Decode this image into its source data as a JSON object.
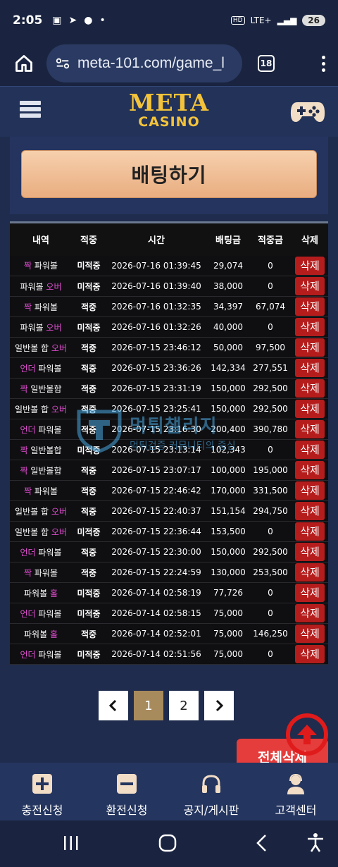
{
  "status_bar": {
    "time": "2:05",
    "battery": "26",
    "network": "LTE+"
  },
  "browser": {
    "url": "meta-101.com/game_l",
    "tab_count": "18"
  },
  "header": {
    "logo_top": "META",
    "logo_bottom": "CASINO"
  },
  "bet_button": "배팅하기",
  "table": {
    "headers": [
      "내역",
      "적중",
      "시간",
      "배팅금",
      "적중금",
      "삭제"
    ],
    "delete_label": "삭제",
    "rows": [
      {
        "game_a": "짝",
        "game_b": " 파워볼",
        "a_pink": true,
        "result": "미적중",
        "time": "2026-07-16 01:39:45",
        "amount": "29,074",
        "win": "0"
      },
      {
        "game_a": "파워볼 ",
        "game_b": "오버",
        "a_pink": false,
        "result": "미적중",
        "time": "2026-07-16 01:39:40",
        "amount": "38,000",
        "win": "0"
      },
      {
        "game_a": "짝",
        "game_b": " 파워볼",
        "a_pink": true,
        "result": "적중",
        "time": "2026-07-16 01:32:35",
        "amount": "34,397",
        "win": "67,074"
      },
      {
        "game_a": "파워볼 ",
        "game_b": "오버",
        "a_pink": false,
        "result": "미적중",
        "time": "2026-07-16 01:32:26",
        "amount": "40,000",
        "win": "0"
      },
      {
        "game_a": "일반볼 합 ",
        "game_b": "오버",
        "a_pink": false,
        "result": "적중",
        "time": "2026-07-15 23:46:12",
        "amount": "50,000",
        "win": "97,500"
      },
      {
        "game_a": "언더",
        "game_b": " 파워볼",
        "a_pink": true,
        "result": "적중",
        "time": "2026-07-15 23:36:26",
        "amount": "142,334",
        "win": "277,551"
      },
      {
        "game_a": "짝",
        "game_b": " 일반볼합",
        "a_pink": true,
        "result": "적중",
        "time": "2026-07-15 23:31:19",
        "amount": "150,000",
        "win": "292,500"
      },
      {
        "game_a": "일반볼 합 ",
        "game_b": "오버",
        "a_pink": false,
        "result": "적중",
        "time": "2026-07-15 23:25:41",
        "amount": "150,000",
        "win": "292,500"
      },
      {
        "game_a": "언더",
        "game_b": " 파워볼",
        "a_pink": true,
        "result": "적중",
        "time": "2026-07-15 23:16:30",
        "amount": "200,400",
        "win": "390,780"
      },
      {
        "game_a": "짝",
        "game_b": " 일반볼합",
        "a_pink": true,
        "result": "미적중",
        "time": "2026-07-15 23:13:14",
        "amount": "102,343",
        "win": "0"
      },
      {
        "game_a": "짝",
        "game_b": " 일반볼합",
        "a_pink": true,
        "result": "적중",
        "time": "2026-07-15 23:07:17",
        "amount": "100,000",
        "win": "195,000"
      },
      {
        "game_a": "짝",
        "game_b": " 파워볼",
        "a_pink": true,
        "result": "적중",
        "time": "2026-07-15 22:46:42",
        "amount": "170,000",
        "win": "331,500"
      },
      {
        "game_a": "일반볼 합 ",
        "game_b": "오버",
        "a_pink": false,
        "result": "적중",
        "time": "2026-07-15 22:40:37",
        "amount": "151,154",
        "win": "294,750"
      },
      {
        "game_a": "일반볼 합 ",
        "game_b": "오버",
        "a_pink": false,
        "result": "미적중",
        "time": "2026-07-15 22:36:44",
        "amount": "153,500",
        "win": "0"
      },
      {
        "game_a": "언더",
        "game_b": " 파워볼",
        "a_pink": true,
        "result": "적중",
        "time": "2026-07-15 22:30:00",
        "amount": "150,000",
        "win": "292,500"
      },
      {
        "game_a": "짝",
        "game_b": " 파워볼",
        "a_pink": true,
        "result": "적중",
        "time": "2026-07-15 22:24:59",
        "amount": "130,000",
        "win": "253,500"
      },
      {
        "game_a": "파워볼 ",
        "game_b": "홀",
        "a_pink": false,
        "result": "미적중",
        "time": "2026-07-14 02:58:19",
        "amount": "77,726",
        "win": "0"
      },
      {
        "game_a": "언더",
        "game_b": " 파워볼",
        "a_pink": true,
        "result": "미적중",
        "time": "2026-07-14 02:58:15",
        "amount": "75,000",
        "win": "0"
      },
      {
        "game_a": "파워볼 ",
        "game_b": "홀",
        "a_pink": false,
        "result": "적중",
        "time": "2026-07-14 02:52:01",
        "amount": "75,000",
        "win": "146,250"
      },
      {
        "game_a": "언더",
        "game_b": " 파워볼",
        "a_pink": true,
        "result": "미적중",
        "time": "2026-07-14 02:51:56",
        "amount": "75,000",
        "win": "0"
      }
    ]
  },
  "watermark": {
    "title": "먹튀챌리지",
    "subtitle": "먹튀검증 커뮤니티의 중심"
  },
  "pagination": {
    "pages": [
      "1",
      "2"
    ],
    "current": "1"
  },
  "delete_all": "전체삭제",
  "bottom_nav": [
    {
      "label": "충전신청",
      "icon": "plus-square-icon"
    },
    {
      "label": "환전신청",
      "icon": "minus-square-icon"
    },
    {
      "label": "공지/게시판",
      "icon": "headphones-icon"
    },
    {
      "label": "고객센터",
      "icon": "support-agent-icon"
    }
  ],
  "colors": {
    "win": "#f3c33a",
    "lose": "#ff3b3b",
    "pink": "#e04ccf",
    "delete": "#b51d1d"
  }
}
